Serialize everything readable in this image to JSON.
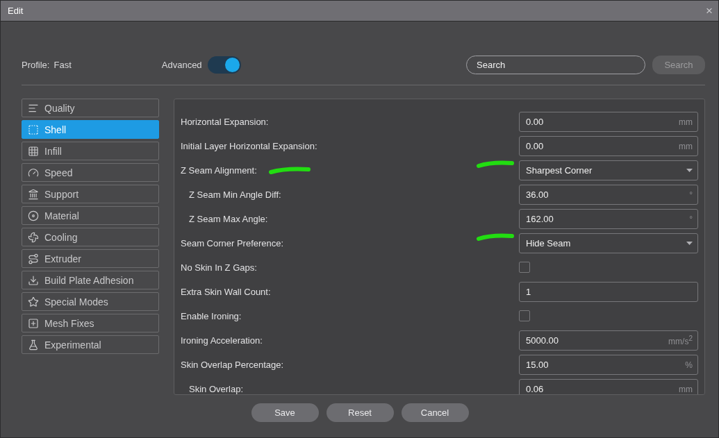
{
  "window": {
    "title": "Edit",
    "close": "×"
  },
  "header": {
    "profile_label": "Profile:",
    "profile_value": "Fast",
    "advanced_label": "Advanced",
    "advanced_on": true,
    "search_placeholder": "Search",
    "search_button": "Search"
  },
  "sidebar": {
    "items": [
      {
        "label": "Quality",
        "selected": false
      },
      {
        "label": "Shell",
        "selected": true
      },
      {
        "label": "Infill",
        "selected": false
      },
      {
        "label": "Speed",
        "selected": false
      },
      {
        "label": "Support",
        "selected": false
      },
      {
        "label": "Material",
        "selected": false
      },
      {
        "label": "Cooling",
        "selected": false
      },
      {
        "label": "Extruder",
        "selected": false
      },
      {
        "label": "Build Plate Adhesion",
        "selected": false
      },
      {
        "label": "Special Modes",
        "selected": false
      },
      {
        "label": "Mesh Fixes",
        "selected": false
      },
      {
        "label": "Experimental",
        "selected": false
      }
    ]
  },
  "settings": [
    {
      "kind": "field",
      "label": "Horizontal Expansion:",
      "value": "0.00",
      "unit": "mm"
    },
    {
      "kind": "field",
      "label": "Initial Layer Horizontal Expansion:",
      "value": "0.00",
      "unit": "mm"
    },
    {
      "kind": "dropdown",
      "label": "Z Seam Alignment:",
      "value": "Sharpest Corner",
      "highlight_label": true,
      "highlight_field": true,
      "children": [
        {
          "kind": "field",
          "label": "Z Seam Min Angle Diff:",
          "value": "36.00",
          "unit": "°"
        },
        {
          "kind": "field",
          "label": "Z Seam Max Angle:",
          "value": "162.00",
          "unit": "°"
        }
      ]
    },
    {
      "kind": "dropdown",
      "label": "Seam Corner Preference:",
      "value": "Hide Seam",
      "highlight_field": true
    },
    {
      "kind": "checkbox",
      "label": "No Skin In Z Gaps:",
      "checked": false
    },
    {
      "kind": "field",
      "label": "Extra Skin Wall Count:",
      "value": "1"
    },
    {
      "kind": "checkbox",
      "label": "Enable Ironing:",
      "checked": false
    },
    {
      "kind": "field",
      "label": "Ironing Acceleration:",
      "value": "5000.00",
      "unit": "mm/s$^{2}$"
    },
    {
      "kind": "field",
      "label": "Skin Overlap Percentage:",
      "value": "15.00",
      "unit": "%",
      "children": [
        {
          "kind": "field",
          "label": "Skin Overlap:",
          "value": "0.06",
          "unit": "mm"
        }
      ]
    }
  ],
  "buttons": [
    "Save",
    "Reset",
    "Cancel"
  ]
}
